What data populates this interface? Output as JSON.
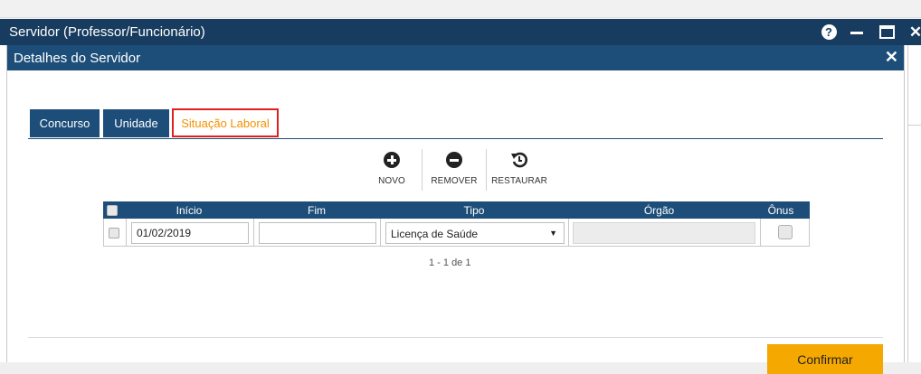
{
  "window": {
    "title": "Servidor (Professor/Funcionário)",
    "help_label": "?"
  },
  "dialog": {
    "title": "Detalhes do Servidor",
    "close_label": "✕"
  },
  "tabs": [
    {
      "label": "Concurso"
    },
    {
      "label": "Unidade"
    },
    {
      "label": "Situação Laboral",
      "active": true
    }
  ],
  "toolbar": {
    "new_label": "NOVO",
    "remove_label": "REMOVER",
    "restore_label": "RESTAURAR"
  },
  "grid": {
    "columns": [
      "Início",
      "Fim",
      "Tipo",
      "Órgão",
      "Ônus"
    ],
    "rows": [
      {
        "selected": false,
        "inicio": "01/02/2019",
        "fim": "",
        "tipo": "Licença de Saúde",
        "orgao": "",
        "onus": false
      }
    ],
    "pager": "1 - 1 de 1"
  },
  "footer": {
    "confirm_label": "Confirmar"
  },
  "colors": {
    "window_title_bg": "#173c5f",
    "dialog_title_bg": "#1d4e79",
    "active_tab_text": "#f39200",
    "active_tab_border": "#e02020",
    "confirm_bg": "#f5a800"
  },
  "icons": {
    "help": "help-circle-icon",
    "minimize": "minimize-icon",
    "maximize": "maximize-icon",
    "close": "close-icon",
    "new": "plus-circle-icon",
    "remove": "minus-circle-icon",
    "restore": "restore-icon",
    "dropdown": "chevron-down-icon"
  }
}
